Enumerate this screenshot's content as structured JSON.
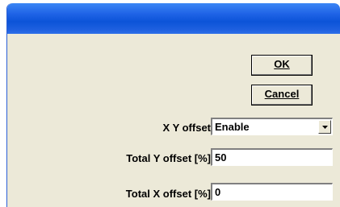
{
  "buttons": {
    "ok_label": "OK",
    "cancel_label": "Cancel"
  },
  "form": {
    "xy_offset": {
      "label": "X Y offset",
      "value": "Enable"
    },
    "total_y_offset": {
      "label": "Total Y offset [%]",
      "value": "50"
    },
    "total_x_offset": {
      "label": "Total X offset [%]",
      "value": "0"
    }
  },
  "colors": {
    "titlebar": "#0c54d8",
    "dialog_bg": "#ece9d8"
  }
}
